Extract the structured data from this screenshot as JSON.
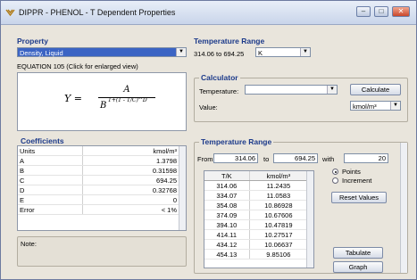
{
  "window": {
    "title": "DIPPR - PHENOL - T Dependent Properties",
    "min": "–",
    "max": "□",
    "close": "✕"
  },
  "property": {
    "heading": "Property",
    "selected": "Density, Liquid",
    "equation_label": "EQUATION 105 (Click for enlarged view)",
    "equation": {
      "lhs": "Y =",
      "num": "A",
      "den_base": "B",
      "den_exp": "1+(1 - T/C)^D"
    }
  },
  "temp_range_top": {
    "heading": "Temperature Range",
    "range_text": "314.06 to 694.25",
    "unit": "K"
  },
  "calculator": {
    "heading": "Calculator",
    "temperature_label": "Temperature:",
    "temperature_value": "",
    "calculate_label": "Calculate",
    "value_label": "Value:",
    "value_unit": "kmol/m³"
  },
  "coefficients": {
    "heading": "Coefficients",
    "header": [
      "Units",
      "kmol/m³"
    ],
    "rows": [
      [
        "A",
        "1.3798"
      ],
      [
        "B",
        "0.31598"
      ],
      [
        "C",
        "694.25"
      ],
      [
        "D",
        "0.32768"
      ],
      [
        "E",
        "0"
      ],
      [
        "Error",
        "< 1%"
      ]
    ]
  },
  "note": {
    "label": "Note:"
  },
  "temp_range_table": {
    "heading": "Temperature Range",
    "from_label": "From",
    "from_value": "314.06",
    "to_label": "to",
    "to_value": "694.25",
    "with_label": "with",
    "with_value": "20",
    "points_label": "Points",
    "increment_label": "Increment",
    "reset_label": "Reset Values",
    "tabulate_label": "Tabulate",
    "graph_label": "Graph",
    "columns": [
      "T/K",
      "kmol/m³"
    ],
    "rows": [
      [
        "314.06",
        "11.2435"
      ],
      [
        "334.07",
        "11.0583"
      ],
      [
        "354.08",
        "10.86928"
      ],
      [
        "374.09",
        "10.67606"
      ],
      [
        "394.10",
        "10.47819"
      ],
      [
        "414.11",
        "10.27517"
      ],
      [
        "434.12",
        "10.06637"
      ],
      [
        "454.13",
        "9.85106"
      ]
    ]
  },
  "colors": {
    "heading": "#1c3a8a",
    "selection": "#3b64c4",
    "close": "#c9472b"
  }
}
